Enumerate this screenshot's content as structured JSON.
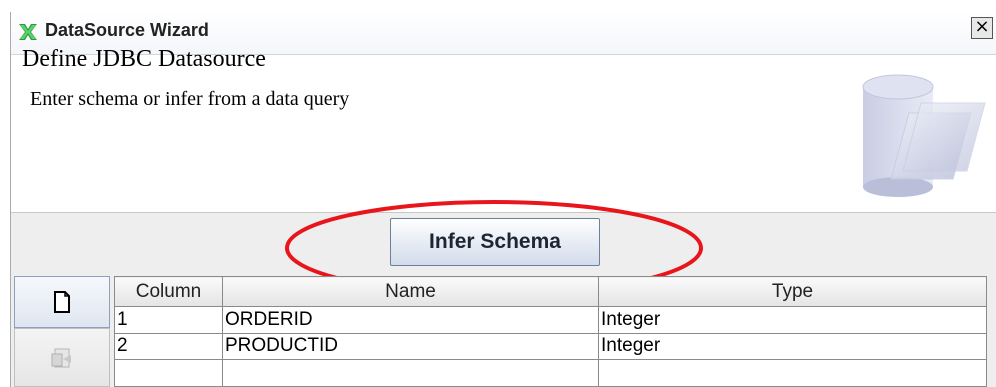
{
  "window": {
    "title": "DataSource Wizard",
    "close_symbol": "×",
    "app_icon": "datasource-wizard-icon"
  },
  "header": {
    "title": "Define JDBC Datasource",
    "subtitle": "Enter schema or infer from a data query",
    "illustration_icon": "database-folder-icon"
  },
  "actions": {
    "infer_schema_label": "Infer Schema"
  },
  "toolbar": {
    "new_icon": "new-document-icon",
    "properties_icon": "properties-icon"
  },
  "schema_table": {
    "headers": [
      "Column",
      "Name",
      "Type"
    ],
    "rows": [
      {
        "column": "1",
        "name": "ORDERID",
        "type": "Integer"
      },
      {
        "column": "2",
        "name": "PRODUCTID",
        "type": "Integer"
      }
    ]
  },
  "colors": {
    "highlight": "#e8161b",
    "button_border": "#6d7f99"
  }
}
